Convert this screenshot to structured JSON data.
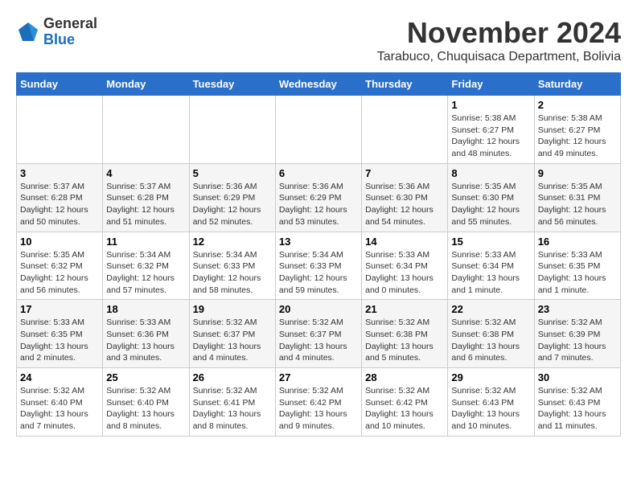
{
  "logo": {
    "general": "General",
    "blue": "Blue"
  },
  "title": "November 2024",
  "subtitle": "Tarabuco, Chuquisaca Department, Bolivia",
  "weekdays": [
    "Sunday",
    "Monday",
    "Tuesday",
    "Wednesday",
    "Thursday",
    "Friday",
    "Saturday"
  ],
  "weeks": [
    [
      {
        "day": "",
        "info": ""
      },
      {
        "day": "",
        "info": ""
      },
      {
        "day": "",
        "info": ""
      },
      {
        "day": "",
        "info": ""
      },
      {
        "day": "",
        "info": ""
      },
      {
        "day": "1",
        "info": "Sunrise: 5:38 AM\nSunset: 6:27 PM\nDaylight: 12 hours\nand 48 minutes."
      },
      {
        "day": "2",
        "info": "Sunrise: 5:38 AM\nSunset: 6:27 PM\nDaylight: 12 hours\nand 49 minutes."
      }
    ],
    [
      {
        "day": "3",
        "info": "Sunrise: 5:37 AM\nSunset: 6:28 PM\nDaylight: 12 hours\nand 50 minutes."
      },
      {
        "day": "4",
        "info": "Sunrise: 5:37 AM\nSunset: 6:28 PM\nDaylight: 12 hours\nand 51 minutes."
      },
      {
        "day": "5",
        "info": "Sunrise: 5:36 AM\nSunset: 6:29 PM\nDaylight: 12 hours\nand 52 minutes."
      },
      {
        "day": "6",
        "info": "Sunrise: 5:36 AM\nSunset: 6:29 PM\nDaylight: 12 hours\nand 53 minutes."
      },
      {
        "day": "7",
        "info": "Sunrise: 5:36 AM\nSunset: 6:30 PM\nDaylight: 12 hours\nand 54 minutes."
      },
      {
        "day": "8",
        "info": "Sunrise: 5:35 AM\nSunset: 6:30 PM\nDaylight: 12 hours\nand 55 minutes."
      },
      {
        "day": "9",
        "info": "Sunrise: 5:35 AM\nSunset: 6:31 PM\nDaylight: 12 hours\nand 56 minutes."
      }
    ],
    [
      {
        "day": "10",
        "info": "Sunrise: 5:35 AM\nSunset: 6:32 PM\nDaylight: 12 hours\nand 56 minutes."
      },
      {
        "day": "11",
        "info": "Sunrise: 5:34 AM\nSunset: 6:32 PM\nDaylight: 12 hours\nand 57 minutes."
      },
      {
        "day": "12",
        "info": "Sunrise: 5:34 AM\nSunset: 6:33 PM\nDaylight: 12 hours\nand 58 minutes."
      },
      {
        "day": "13",
        "info": "Sunrise: 5:34 AM\nSunset: 6:33 PM\nDaylight: 12 hours\nand 59 minutes."
      },
      {
        "day": "14",
        "info": "Sunrise: 5:33 AM\nSunset: 6:34 PM\nDaylight: 13 hours\nand 0 minutes."
      },
      {
        "day": "15",
        "info": "Sunrise: 5:33 AM\nSunset: 6:34 PM\nDaylight: 13 hours\nand 1 minute."
      },
      {
        "day": "16",
        "info": "Sunrise: 5:33 AM\nSunset: 6:35 PM\nDaylight: 13 hours\nand 1 minute."
      }
    ],
    [
      {
        "day": "17",
        "info": "Sunrise: 5:33 AM\nSunset: 6:35 PM\nDaylight: 13 hours\nand 2 minutes."
      },
      {
        "day": "18",
        "info": "Sunrise: 5:33 AM\nSunset: 6:36 PM\nDaylight: 13 hours\nand 3 minutes."
      },
      {
        "day": "19",
        "info": "Sunrise: 5:32 AM\nSunset: 6:37 PM\nDaylight: 13 hours\nand 4 minutes."
      },
      {
        "day": "20",
        "info": "Sunrise: 5:32 AM\nSunset: 6:37 PM\nDaylight: 13 hours\nand 4 minutes."
      },
      {
        "day": "21",
        "info": "Sunrise: 5:32 AM\nSunset: 6:38 PM\nDaylight: 13 hours\nand 5 minutes."
      },
      {
        "day": "22",
        "info": "Sunrise: 5:32 AM\nSunset: 6:38 PM\nDaylight: 13 hours\nand 6 minutes."
      },
      {
        "day": "23",
        "info": "Sunrise: 5:32 AM\nSunset: 6:39 PM\nDaylight: 13 hours\nand 7 minutes."
      }
    ],
    [
      {
        "day": "24",
        "info": "Sunrise: 5:32 AM\nSunset: 6:40 PM\nDaylight: 13 hours\nand 7 minutes."
      },
      {
        "day": "25",
        "info": "Sunrise: 5:32 AM\nSunset: 6:40 PM\nDaylight: 13 hours\nand 8 minutes."
      },
      {
        "day": "26",
        "info": "Sunrise: 5:32 AM\nSunset: 6:41 PM\nDaylight: 13 hours\nand 8 minutes."
      },
      {
        "day": "27",
        "info": "Sunrise: 5:32 AM\nSunset: 6:42 PM\nDaylight: 13 hours\nand 9 minutes."
      },
      {
        "day": "28",
        "info": "Sunrise: 5:32 AM\nSunset: 6:42 PM\nDaylight: 13 hours\nand 10 minutes."
      },
      {
        "day": "29",
        "info": "Sunrise: 5:32 AM\nSunset: 6:43 PM\nDaylight: 13 hours\nand 10 minutes."
      },
      {
        "day": "30",
        "info": "Sunrise: 5:32 AM\nSunset: 6:43 PM\nDaylight: 13 hours\nand 11 minutes."
      }
    ]
  ]
}
